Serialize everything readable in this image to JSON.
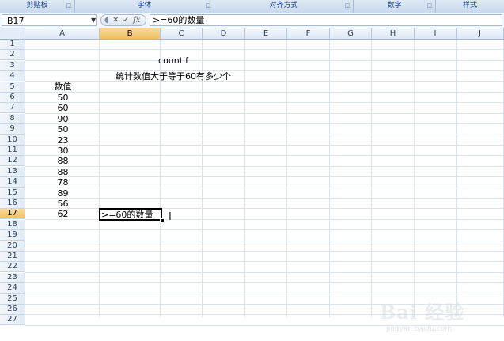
{
  "ribbon": {
    "groups": [
      {
        "label": "剪贴板"
      },
      {
        "label": "字体"
      },
      {
        "label": "对齐方式"
      },
      {
        "label": "数字"
      },
      {
        "label": "样式"
      }
    ]
  },
  "formula_bar": {
    "name_box": "B17",
    "formula": ">=60的数量"
  },
  "columns": [
    "A",
    "B",
    "C",
    "D",
    "E",
    "F",
    "G",
    "H",
    "I",
    "J"
  ],
  "rows": [
    1,
    2,
    3,
    4,
    5,
    6,
    7,
    8,
    9,
    10,
    11,
    12,
    13,
    14,
    15,
    16,
    17,
    18,
    19,
    20,
    21,
    22,
    23,
    24,
    25,
    26,
    27
  ],
  "selected": {
    "col": "B",
    "row": 17
  },
  "cells": {
    "title": "countif",
    "subtitle": "统计数值大于等于60有多少个",
    "header_a5": "数值",
    "values": [
      "50",
      "60",
      "90",
      "50",
      "23",
      "30",
      "88",
      "88",
      "78",
      "89",
      "56",
      "62"
    ],
    "b17": ">=60的数量"
  },
  "watermark": {
    "brand": "Bai 经验",
    "url": "jingyan.baidu.com"
  },
  "colors": {
    "selection_header": "#f1c15f",
    "grid_line": "#dbe3ee",
    "header_text": "#27415f"
  }
}
